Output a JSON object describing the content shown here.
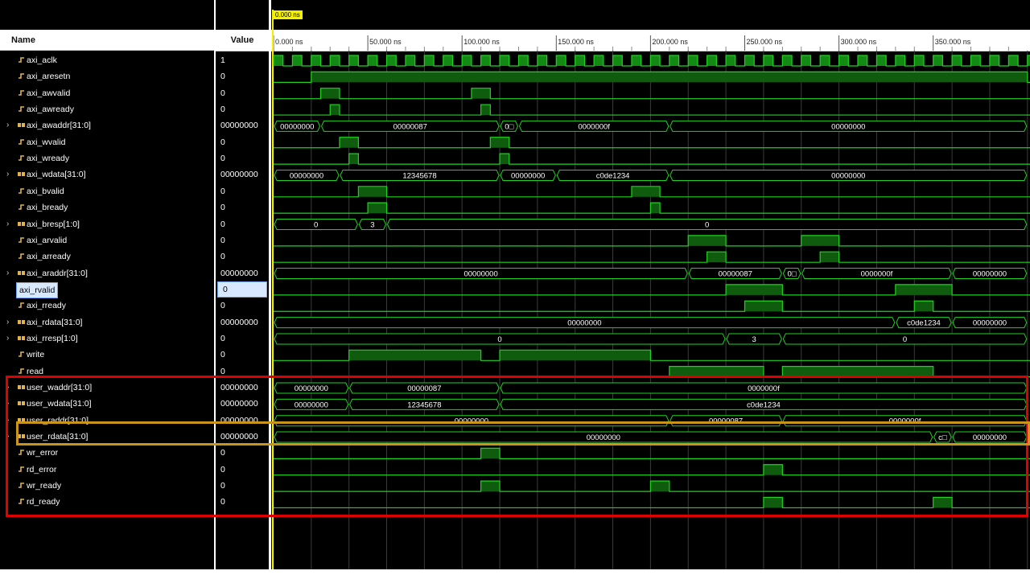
{
  "headers": {
    "name": "Name",
    "value": "Value"
  },
  "cursor": {
    "label": "0.000 ns"
  },
  "timeline": {
    "ticks": [
      "0.000 ns",
      "50.000 ns",
      "100.000 ns",
      "150.000 ns",
      "200.000 ns",
      "250.000 ns",
      "300.000 ns",
      "350.000 ns"
    ]
  },
  "colors": {
    "wave": "#1fd21f",
    "bus_fill": "#0f5c0f",
    "high_fill": "#138a13",
    "grid": "#3b3b3b",
    "highlight_red": "#e00000",
    "highlight_gold": "#c8951a"
  },
  "signals": [
    {
      "name": "axi_aclk",
      "value": "1",
      "bus": false
    },
    {
      "name": "axi_aresetn",
      "value": "0",
      "bus": false
    },
    {
      "name": "axi_awvalid",
      "value": "0",
      "bus": false
    },
    {
      "name": "axi_awready",
      "value": "0",
      "bus": false
    },
    {
      "name": "axi_awaddr[31:0]",
      "value": "00000000",
      "bus": true
    },
    {
      "name": "axi_wvalid",
      "value": "0",
      "bus": false
    },
    {
      "name": "axi_wready",
      "value": "0",
      "bus": false
    },
    {
      "name": "axi_wdata[31:0]",
      "value": "00000000",
      "bus": true
    },
    {
      "name": "axi_bvalid",
      "value": "0",
      "bus": false
    },
    {
      "name": "axi_bready",
      "value": "0",
      "bus": false
    },
    {
      "name": "axi_bresp[1:0]",
      "value": "0",
      "bus": true
    },
    {
      "name": "axi_arvalid",
      "value": "0",
      "bus": false
    },
    {
      "name": "axi_arready",
      "value": "0",
      "bus": false
    },
    {
      "name": "axi_araddr[31:0]",
      "value": "00000000",
      "bus": true
    },
    {
      "name": "axi_rvalid",
      "value": "0",
      "bus": false,
      "selected": true
    },
    {
      "name": "axi_rready",
      "value": "0",
      "bus": false
    },
    {
      "name": "axi_rdata[31:0]",
      "value": "00000000",
      "bus": true
    },
    {
      "name": "axi_rresp[1:0]",
      "value": "0",
      "bus": true
    },
    {
      "name": "write",
      "value": "0",
      "bus": false
    },
    {
      "name": "read",
      "value": "0",
      "bus": false
    },
    {
      "name": "user_waddr[31:0]",
      "value": "00000000",
      "bus": true
    },
    {
      "name": "user_wdata[31:0]",
      "value": "00000000",
      "bus": true
    },
    {
      "name": "user_raddr[31:0]",
      "value": "00000000",
      "bus": true
    },
    {
      "name": "user_rdata[31:0]",
      "value": "00000000",
      "bus": true
    },
    {
      "name": "wr_error",
      "value": "0",
      "bus": false
    },
    {
      "name": "rd_error",
      "value": "0",
      "bus": false
    },
    {
      "name": "wr_ready",
      "value": "0",
      "bus": false
    },
    {
      "name": "rd_ready",
      "value": "0",
      "bus": false
    }
  ],
  "waves": [
    {
      "type": "clock",
      "period_ns": 10
    },
    {
      "type": "bit",
      "pulses": [
        [
          20,
          400
        ]
      ]
    },
    {
      "type": "bit",
      "pulses": [
        [
          25,
          35
        ],
        [
          105,
          115
        ]
      ]
    },
    {
      "type": "bit",
      "pulses": [
        [
          30,
          35
        ],
        [
          110,
          115
        ]
      ]
    },
    {
      "type": "bus",
      "segments": [
        [
          0,
          25,
          "00000000"
        ],
        [
          25,
          120,
          "00000087"
        ],
        [
          120,
          130,
          "0□"
        ],
        [
          130,
          210,
          "0000000f"
        ],
        [
          210,
          400,
          "00000000"
        ]
      ]
    },
    {
      "type": "bit",
      "pulses": [
        [
          35,
          45
        ],
        [
          115,
          125
        ]
      ]
    },
    {
      "type": "bit",
      "pulses": [
        [
          40,
          45
        ],
        [
          120,
          125
        ]
      ]
    },
    {
      "type": "bus",
      "segments": [
        [
          0,
          35,
          "00000000"
        ],
        [
          35,
          120,
          "12345678"
        ],
        [
          120,
          150,
          "00000000"
        ],
        [
          150,
          210,
          "c0de1234"
        ],
        [
          210,
          400,
          "00000000"
        ]
      ]
    },
    {
      "type": "bit",
      "pulses": [
        [
          45,
          60
        ],
        [
          190,
          205
        ]
      ]
    },
    {
      "type": "bit",
      "pulses": [
        [
          50,
          60
        ],
        [
          200,
          205
        ]
      ]
    },
    {
      "type": "bus",
      "segments": [
        [
          0,
          45,
          "0"
        ],
        [
          45,
          60,
          "3"
        ],
        [
          60,
          400,
          "0"
        ]
      ]
    },
    {
      "type": "bit",
      "pulses": [
        [
          220,
          240
        ],
        [
          280,
          300
        ]
      ]
    },
    {
      "type": "bit",
      "pulses": [
        [
          230,
          240
        ],
        [
          290,
          300
        ]
      ]
    },
    {
      "type": "bus",
      "segments": [
        [
          0,
          220,
          "00000000"
        ],
        [
          220,
          270,
          "00000087"
        ],
        [
          270,
          280,
          "0□"
        ],
        [
          280,
          360,
          "0000000f"
        ],
        [
          360,
          400,
          "00000000"
        ]
      ]
    },
    {
      "type": "bit",
      "pulses": [
        [
          240,
          270
        ],
        [
          330,
          360
        ]
      ]
    },
    {
      "type": "bit",
      "pulses": [
        [
          250,
          270
        ],
        [
          340,
          350
        ]
      ]
    },
    {
      "type": "bus",
      "segments": [
        [
          0,
          330,
          "00000000"
        ],
        [
          330,
          360,
          "c0de1234"
        ],
        [
          360,
          400,
          "00000000"
        ]
      ]
    },
    {
      "type": "bus",
      "segments": [
        [
          0,
          240,
          "0"
        ],
        [
          240,
          270,
          "3"
        ],
        [
          270,
          400,
          "0"
        ]
      ]
    },
    {
      "type": "bit",
      "pulses": [
        [
          40,
          110
        ],
        [
          120,
          200
        ]
      ]
    },
    {
      "type": "bit",
      "pulses": [
        [
          210,
          260
        ],
        [
          270,
          350
        ]
      ]
    },
    {
      "type": "bus",
      "segments": [
        [
          0,
          40,
          "00000000"
        ],
        [
          40,
          120,
          "00000087"
        ],
        [
          120,
          400,
          "0000000f"
        ]
      ]
    },
    {
      "type": "bus",
      "segments": [
        [
          0,
          40,
          "00000000"
        ],
        [
          40,
          120,
          "12345678"
        ],
        [
          120,
          400,
          "c0de1234"
        ]
      ]
    },
    {
      "type": "bus",
      "segments": [
        [
          0,
          210,
          "00000000"
        ],
        [
          210,
          270,
          "00000087"
        ],
        [
          270,
          400,
          "0000000f"
        ]
      ]
    },
    {
      "type": "bus",
      "segments": [
        [
          0,
          350,
          "00000000"
        ],
        [
          350,
          360,
          "c□"
        ],
        [
          360,
          400,
          "00000000"
        ]
      ]
    },
    {
      "type": "bit",
      "pulses": [
        [
          110,
          120
        ]
      ]
    },
    {
      "type": "bit",
      "pulses": [
        [
          260,
          270
        ]
      ]
    },
    {
      "type": "bit",
      "pulses": [
        [
          110,
          120
        ],
        [
          200,
          210
        ]
      ]
    },
    {
      "type": "bit",
      "pulses": [
        [
          260,
          270
        ],
        [
          350,
          360
        ]
      ]
    }
  ]
}
